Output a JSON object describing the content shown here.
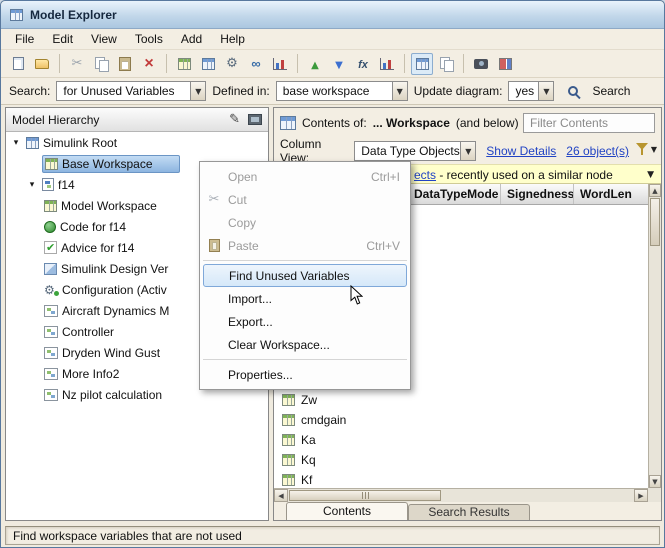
{
  "window": {
    "title": "Model Explorer"
  },
  "menubar": {
    "items": [
      "File",
      "Edit",
      "View",
      "Tools",
      "Add",
      "Help"
    ]
  },
  "toolbar": {
    "icons": [
      "new-model-icon",
      "open-icon",
      "cut-icon",
      "copy-icon",
      "paste-icon",
      "delete-icon",
      "workspace-table-icon",
      "data-table-icon",
      "engine-gear-icon",
      "link-library-icon",
      "chart-icon",
      "export-up-icon",
      "import-down-icon",
      "function-fx-icon",
      "bar-chart-icon",
      "table-view-icon",
      "split-view-icon",
      "snapshot-icon",
      "colored-grid-icon"
    ]
  },
  "searchbar": {
    "search_label": "Search:",
    "search_type_value": "for Unused Variables",
    "defined_in_label": "Defined in:",
    "defined_in_value": "base workspace",
    "update_diagram_label": "Update diagram:",
    "update_diagram_value": "yes",
    "search_button_label": "Search"
  },
  "hierarchy": {
    "header": "Model Hierarchy",
    "items": [
      {
        "label": "Simulink Root",
        "level": 0,
        "icon": "simulink-root-icon",
        "expanded": true
      },
      {
        "label": "Base Workspace",
        "level": 1,
        "icon": "workspace-grid-icon",
        "selected": true
      },
      {
        "label": "f14",
        "level": 1,
        "icon": "model-icon",
        "expanded": true
      },
      {
        "label": "Model Workspace",
        "level": 2,
        "icon": "workspace-grid-icon"
      },
      {
        "label": "Code for f14",
        "level": 2,
        "icon": "code-icon"
      },
      {
        "label": "Advice for f14",
        "level": 2,
        "icon": "advice-check-icon"
      },
      {
        "label": "Simulink Design Ver",
        "level": 2,
        "icon": "design-verifier-icon"
      },
      {
        "label": "Configuration (Activ",
        "level": 2,
        "icon": "config-gear-icon"
      },
      {
        "label": "Aircraft Dynamics M",
        "level": 2,
        "icon": "subsystem-icon"
      },
      {
        "label": "Controller",
        "level": 2,
        "icon": "subsystem-icon"
      },
      {
        "label": "Dryden Wind Gust",
        "level": 2,
        "icon": "subsystem-icon"
      },
      {
        "label": "More Info2",
        "level": 2,
        "icon": "subsystem-icon"
      },
      {
        "label": "Nz pilot calculation",
        "level": 2,
        "icon": "subsystem-icon"
      }
    ]
  },
  "context_menu": {
    "items": [
      {
        "label": "Open",
        "shortcut": "Ctrl+I",
        "enabled": false
      },
      {
        "label": "Cut",
        "icon": "scissors-icon",
        "enabled": false
      },
      {
        "label": "Copy",
        "enabled": false
      },
      {
        "label": "Paste",
        "shortcut": "Ctrl+V",
        "icon": "clipboard-icon",
        "enabled": false
      },
      {
        "separator": true
      },
      {
        "label": "Find Unused Variables",
        "highlighted": true,
        "enabled": true
      },
      {
        "label": "Import...",
        "enabled": true
      },
      {
        "label": "Export...",
        "enabled": true
      },
      {
        "label": "Clear Workspace...",
        "enabled": true
      },
      {
        "separator": true
      },
      {
        "label": "Properties...",
        "enabled": true
      }
    ]
  },
  "contents_panel": {
    "contents_of_label": "Contents of:",
    "contents_of_value": "... Workspace",
    "contents_of_suffix": "(and below)",
    "filter_placeholder": "Filter Contents",
    "column_view_label": "Column View:",
    "column_view_value": "Data Type Objects",
    "show_details_link": "Show Details",
    "object_count_link": "26 object(s)",
    "notice_link_fragment": "ects",
    "notice_text": " - recently used on a similar node",
    "table": {
      "columns": [
        "DataTypeMode",
        "Signedness",
        "WordLen"
      ],
      "rows": [
        {
          "name": "Zw"
        },
        {
          "name": "cmdgain"
        },
        {
          "name": "Ka"
        },
        {
          "name": "Kq"
        },
        {
          "name": "Kf"
        }
      ]
    },
    "tabs": [
      {
        "label": "Contents",
        "active": true
      },
      {
        "label": "Search Results",
        "active": false
      }
    ]
  },
  "statusbar": {
    "text": "Find workspace variables that are not used"
  },
  "colors": {
    "selection_blue": "#8db5e0",
    "menu_highlight": "#d5e8f9",
    "notice_yellow": "#ffffcb",
    "link_blue": "#2143c4",
    "titlebar_blue": "#b9d1e8"
  }
}
